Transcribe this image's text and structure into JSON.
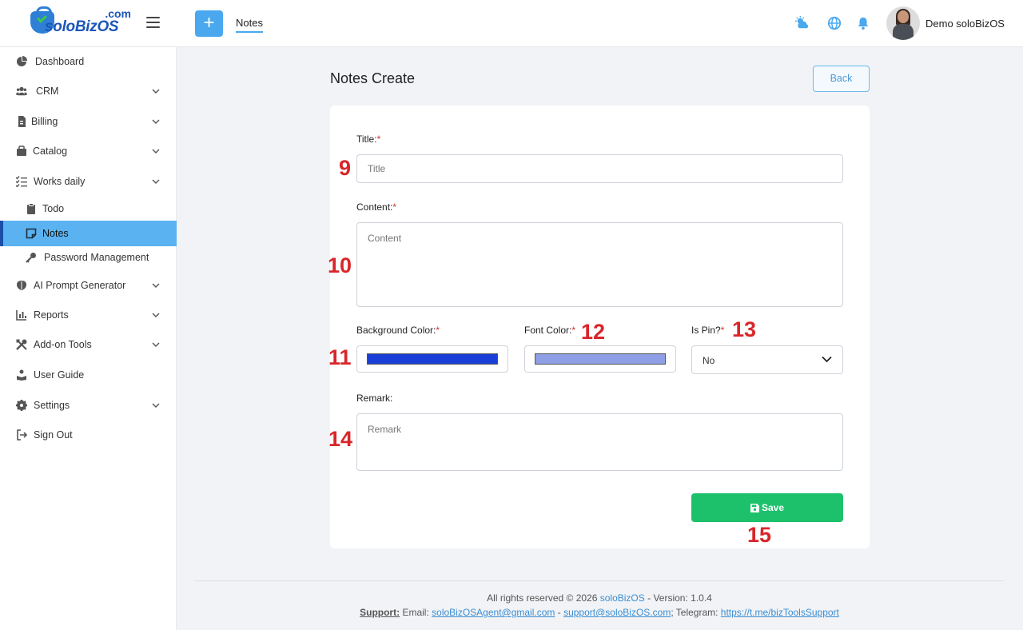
{
  "brand": {
    "logo_name": "soloBizOS",
    "logo_suffix": ".com"
  },
  "topbar": {
    "tab": "Notes",
    "username": "Demo soloBizOS"
  },
  "sidebar": {
    "items": [
      {
        "label": "Dashboard",
        "icon": "dashboard-icon"
      },
      {
        "label": "CRM",
        "icon": "users-icon",
        "expandable": true
      },
      {
        "label": "Billing",
        "icon": "billing-icon",
        "expandable": true
      },
      {
        "label": "Catalog",
        "icon": "catalog-icon",
        "expandable": true
      },
      {
        "label": "Works daily",
        "icon": "tasks-icon",
        "expandable": true
      },
      {
        "label": "Todo",
        "icon": "clipboard-icon",
        "sub": true
      },
      {
        "label": "Notes",
        "icon": "note-icon",
        "sub": true,
        "active": true
      },
      {
        "label": "Password Management",
        "icon": "key-icon",
        "sub": true
      },
      {
        "label": "AI Prompt Generator",
        "icon": "brain-icon",
        "expandable": true
      },
      {
        "label": "Reports",
        "icon": "chart-icon",
        "expandable": true
      },
      {
        "label": "Add-on Tools",
        "icon": "tools-icon",
        "expandable": true
      },
      {
        "label": "User Guide",
        "icon": "guide-icon"
      },
      {
        "label": "Settings",
        "icon": "gear-icon",
        "expandable": true
      },
      {
        "label": "Sign Out",
        "icon": "sign-out-icon"
      }
    ]
  },
  "page": {
    "title": "Notes Create",
    "back_label": "Back"
  },
  "form": {
    "title": {
      "label": "Title:",
      "required": "*",
      "placeholder": "Title"
    },
    "content": {
      "label": "Content:",
      "required": "*",
      "placeholder": "Content"
    },
    "background_color": {
      "label": "Background Color:",
      "required": "*",
      "value": "#1a3fd6"
    },
    "font_color": {
      "label": "Font Color:",
      "required": "*",
      "value": "#8f9fe6"
    },
    "is_pin": {
      "label": "Is Pin?",
      "required": "*",
      "value": "No"
    },
    "remark": {
      "label": "Remark:",
      "placeholder": "Remark"
    },
    "save_label": "Save"
  },
  "annotations": {
    "title": "9",
    "content": "10",
    "background_color": "11",
    "font_color": "12",
    "is_pin": "13",
    "remark": "14",
    "save": "15"
  },
  "footer": {
    "rights": "All rights reserved © 2026",
    "brand": "soloBizOS",
    "version": "- Version: 1.0.4",
    "support_label": "Support:",
    "email_label": "Email:",
    "email1": "soloBizOSAgent@gmail.com",
    "separator": "-",
    "email2": "support@soloBizOS.com",
    "telegram_label": "; Telegram:",
    "telegram": "https://t.me/bizToolsSupport"
  },
  "colors": {
    "accent": "#4aa8ef",
    "active_nav": "#5ab2f0",
    "save": "#1dc16c",
    "required": "#d0302b",
    "annotation": "#d9262a"
  }
}
